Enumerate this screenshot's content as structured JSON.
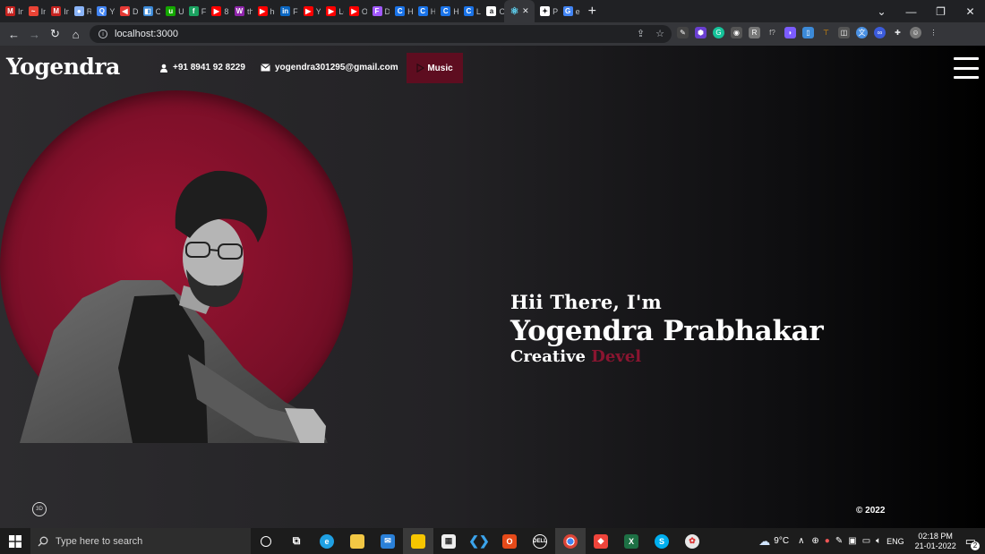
{
  "browser": {
    "tabs": [
      {
        "label": "In",
        "color": "#c5221f",
        "glyph": "M"
      },
      {
        "label": "In",
        "color": "#ea4335",
        "glyph": "~"
      },
      {
        "label": "In",
        "color": "#c5221f",
        "glyph": "M"
      },
      {
        "label": "Re",
        "color": "#8ab4f8",
        "glyph": "●"
      },
      {
        "label": "Yo",
        "color": "#4285f4",
        "glyph": "Q"
      },
      {
        "label": "Di",
        "color": "#e53935",
        "glyph": "◀"
      },
      {
        "label": "Cl",
        "color": "#3c8ad8",
        "glyph": "◧"
      },
      {
        "label": "Up",
        "color": "#14a800",
        "glyph": "u"
      },
      {
        "label": "Fi",
        "color": "#1aa260",
        "glyph": "f"
      },
      {
        "label": "8",
        "color": "#ff0000",
        "glyph": "▶"
      },
      {
        "label": "th",
        "color": "#8e24aa",
        "glyph": "W"
      },
      {
        "label": "hc",
        "color": "#ff0000",
        "glyph": "▶"
      },
      {
        "label": "Fe",
        "color": "#0a66c2",
        "glyph": "in"
      },
      {
        "label": "Yc",
        "color": "#ff0000",
        "glyph": "▶"
      },
      {
        "label": "Le",
        "color": "#ff0000",
        "glyph": "▶"
      },
      {
        "label": "Ol",
        "color": "#ff0000",
        "glyph": "▶"
      },
      {
        "label": "Di",
        "color": "#a259ff",
        "glyph": "F"
      },
      {
        "label": "H",
        "color": "#1a73e8",
        "glyph": "C"
      },
      {
        "label": "H",
        "color": "#1a73e8",
        "glyph": "C"
      },
      {
        "label": "H",
        "color": "#1a73e8",
        "glyph": "C"
      },
      {
        "label": "Le",
        "color": "#1a73e8",
        "glyph": "C"
      },
      {
        "label": "O",
        "color": "#ffffff",
        "glyph": "a"
      }
    ],
    "active_tab": {
      "color": "#61dafb",
      "glyph": "⚛"
    },
    "tabs_after": [
      {
        "label": "Pr",
        "color": "#ffffff",
        "glyph": "✦"
      },
      {
        "label": "er",
        "color": "#4285f4",
        "glyph": "G"
      }
    ],
    "new_tab": "+",
    "url": "localhost:3000"
  },
  "site": {
    "brand": "Yogendra",
    "phone": "+91 8941 92 8229",
    "email": "yogendra301295@gmail.com",
    "music_label": "Music",
    "greeting": "Hii There, I'm",
    "name": "Yogendra Prabhakar",
    "role_prefix": "Creative ",
    "role_typed": "Devel",
    "badge": "3D",
    "copyright": "© 2022"
  },
  "taskbar": {
    "search_placeholder": "Type here to search",
    "weather": "9°C",
    "language": "ENG",
    "time": "02:18 PM",
    "date": "21-01-2022",
    "notifications": "2"
  },
  "colors": {
    "accent": "#8a1530",
    "music_bg": "#5e0d20",
    "circle": "#8c1230"
  }
}
